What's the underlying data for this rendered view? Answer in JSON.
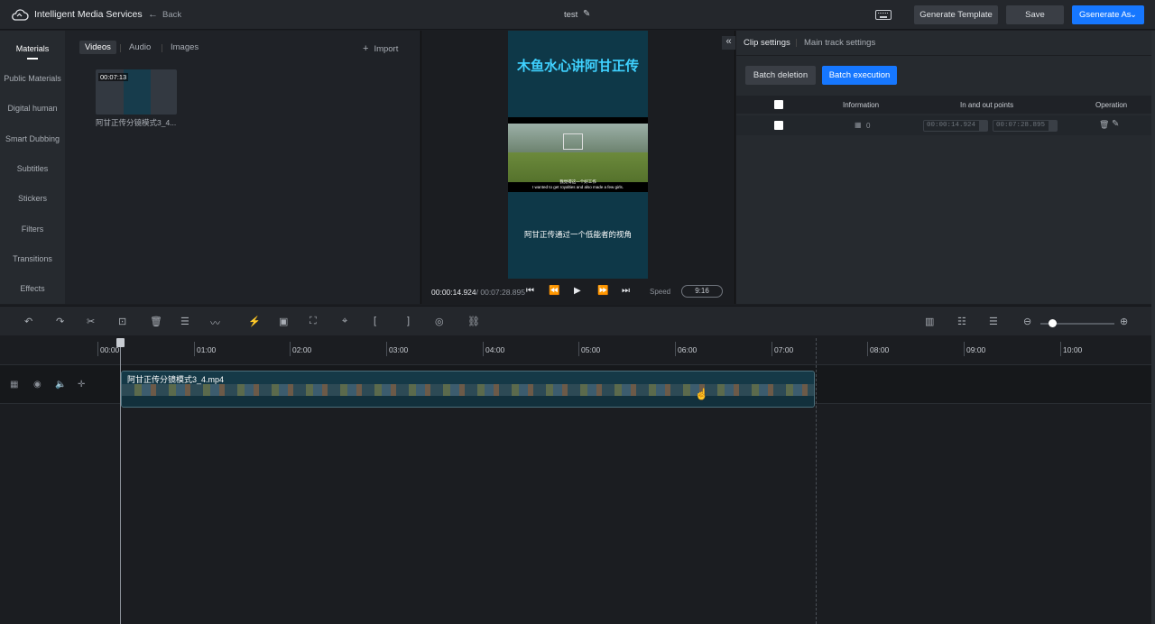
{
  "topbar": {
    "app_title": "Intelligent Media Services",
    "back_label": "Back",
    "project_name": "test",
    "generate_template_label": "Generate Template",
    "save_label": "Save",
    "generate_as_label": "Gsenerate As"
  },
  "left_nav": {
    "items": [
      {
        "label": "Materials"
      },
      {
        "label": "Public Materials"
      },
      {
        "label": "Digital human"
      },
      {
        "label": "Smart Dubbing"
      },
      {
        "label": "Subtitles"
      },
      {
        "label": "Stickers"
      },
      {
        "label": "Filters"
      },
      {
        "label": "Transitions"
      },
      {
        "label": "Effects"
      }
    ]
  },
  "materials": {
    "tabs": [
      {
        "label": "Videos"
      },
      {
        "label": "Audio"
      },
      {
        "label": "Images"
      }
    ],
    "import_label": "Import",
    "item": {
      "duration": "00:07:13",
      "name": "阿甘正传分镜模式3_4..."
    }
  },
  "preview": {
    "title_text": "木鱼水心讲阿甘正传",
    "video_subtitle_cn": "我觉得这一个好工作",
    "video_subtitle_en": "I wanted to get royalties and also made a few girls.",
    "caption": "阿甘正传通过一个低能者的视角",
    "current_time": "00:00:14.924",
    "total_time": "/ 00:07:28.895",
    "speed_label": "Speed",
    "ratio": "9:16"
  },
  "clip_settings": {
    "tabs": [
      {
        "label": "Clip settings"
      },
      {
        "label": "Main track settings"
      }
    ],
    "batch_deletion_label": "Batch deletion",
    "batch_execution_label": "Batch execution",
    "columns": [
      "Information",
      "In and out points",
      "Operation"
    ],
    "row": {
      "info_value": "0",
      "in_point": "00:00:14.924",
      "out_point": "00:07:28.895"
    }
  },
  "timeline": {
    "ticks": [
      "00:00",
      "01:00",
      "02:00",
      "03:00",
      "04:00",
      "05:00",
      "06:00",
      "07:00",
      "08:00",
      "09:00",
      "10:00"
    ],
    "clip_name": "阿甘正传分镜模式3_4.mp4"
  },
  "colors": {
    "accent": "#1677ff",
    "background": "#1b1d21",
    "panel": "#262a2f"
  }
}
